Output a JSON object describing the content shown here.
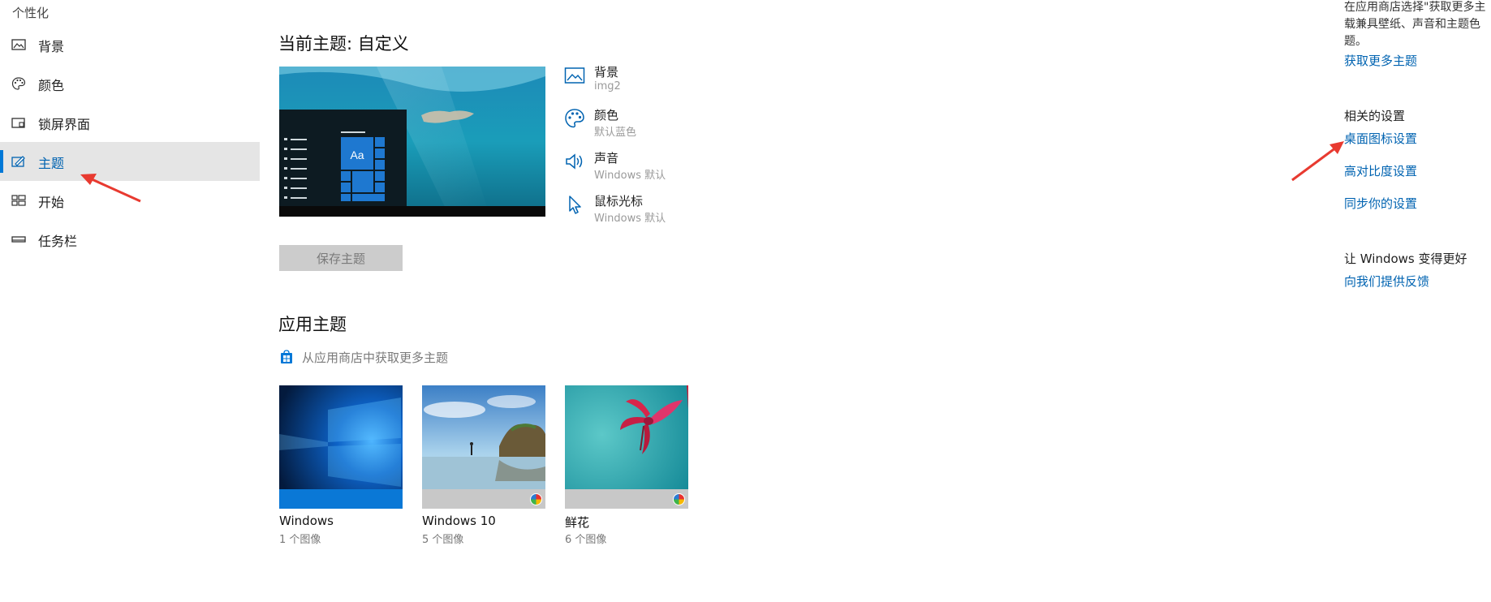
{
  "sidebar": {
    "title": "个性化",
    "items": [
      {
        "label": "背景",
        "icon": "picture-icon"
      },
      {
        "label": "颜色",
        "icon": "palette-icon"
      },
      {
        "label": "锁屏界面",
        "icon": "lock-screen-icon"
      },
      {
        "label": "主题",
        "icon": "theme-brush-icon",
        "active": true
      },
      {
        "label": "开始",
        "icon": "start-grid-icon"
      },
      {
        "label": "任务栏",
        "icon": "taskbar-icon"
      }
    ]
  },
  "main": {
    "current_theme_title": "当前主题: 自定义",
    "summary": [
      {
        "name": "背景",
        "value": "img2",
        "icon": "picture-icon"
      },
      {
        "name": "颜色",
        "value": "默认蓝色",
        "icon": "palette-icon"
      },
      {
        "name": "声音",
        "value": "Windows 默认",
        "icon": "speaker-icon"
      },
      {
        "name": "鼠标光标",
        "value": "Windows 默认",
        "icon": "cursor-icon"
      }
    ],
    "save_button": "保存主题",
    "apply_theme_title": "应用主题",
    "store_link": "从应用商店中获取更多主题",
    "preview_tile_text": "Aa",
    "themes": [
      {
        "name": "Windows",
        "count": "1 个图像"
      },
      {
        "name": "Windows 10",
        "count": "5 个图像"
      },
      {
        "name": "鲜花",
        "count": "6 个图像"
      }
    ]
  },
  "right": {
    "intro_lines": [
      "在应用商店选择\"获取更多主",
      "载兼具壁纸、声音和主题色",
      "题。"
    ],
    "get_more_link": "获取更多主题",
    "related_title": "相关的设置",
    "related_links": [
      "桌面图标设置",
      "高对比度设置",
      "同步你的设置"
    ],
    "feedback_title": "让 Windows 变得更好",
    "feedback_link": "向我们提供反馈"
  },
  "colors": {
    "accent": "#0078d7",
    "link": "#0063b1",
    "annotation_arrow": "#e83a30"
  }
}
